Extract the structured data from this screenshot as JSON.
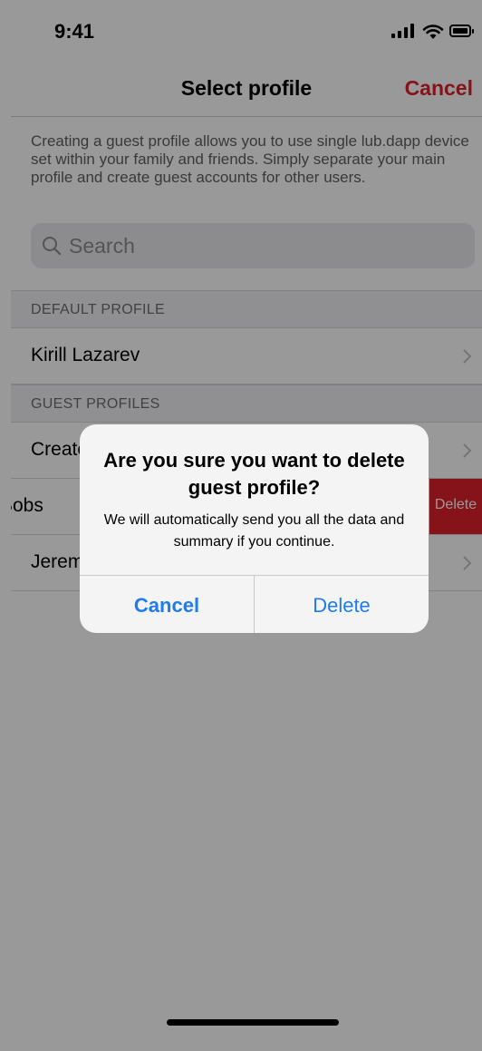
{
  "status_bar": {
    "time": "9:41"
  },
  "nav": {
    "title": "Select profile",
    "cancel_label": "Cancel"
  },
  "intro_text": "Creating a guest profile allows you to use single lub.dapp device set within your family and friends. Simply separate your main profile and create guest accounts for other users.",
  "search": {
    "placeholder": "Search"
  },
  "sections": {
    "default": {
      "header": "DEFAULT PROFILE",
      "items": [
        {
          "label": "Kirill Lazarev"
        }
      ]
    },
    "guest": {
      "header": "GUEST PROFILES",
      "items": [
        {
          "label": "Create"
        },
        {
          "label": "Bobs",
          "swipe_action": "Delete"
        },
        {
          "label": "Jeremy"
        }
      ]
    }
  },
  "alert": {
    "title": "Are you sure you want to delete guest profile?",
    "message": "We will automatically send you all the data and summary if you continue.",
    "cancel_label": "Cancel",
    "delete_label": "Delete"
  },
  "colors": {
    "accent_red": "#e0202a",
    "alert_blue": "#1e7cf0"
  },
  "icons": {
    "search": "search-icon",
    "chevron": "chevron-right-icon"
  }
}
